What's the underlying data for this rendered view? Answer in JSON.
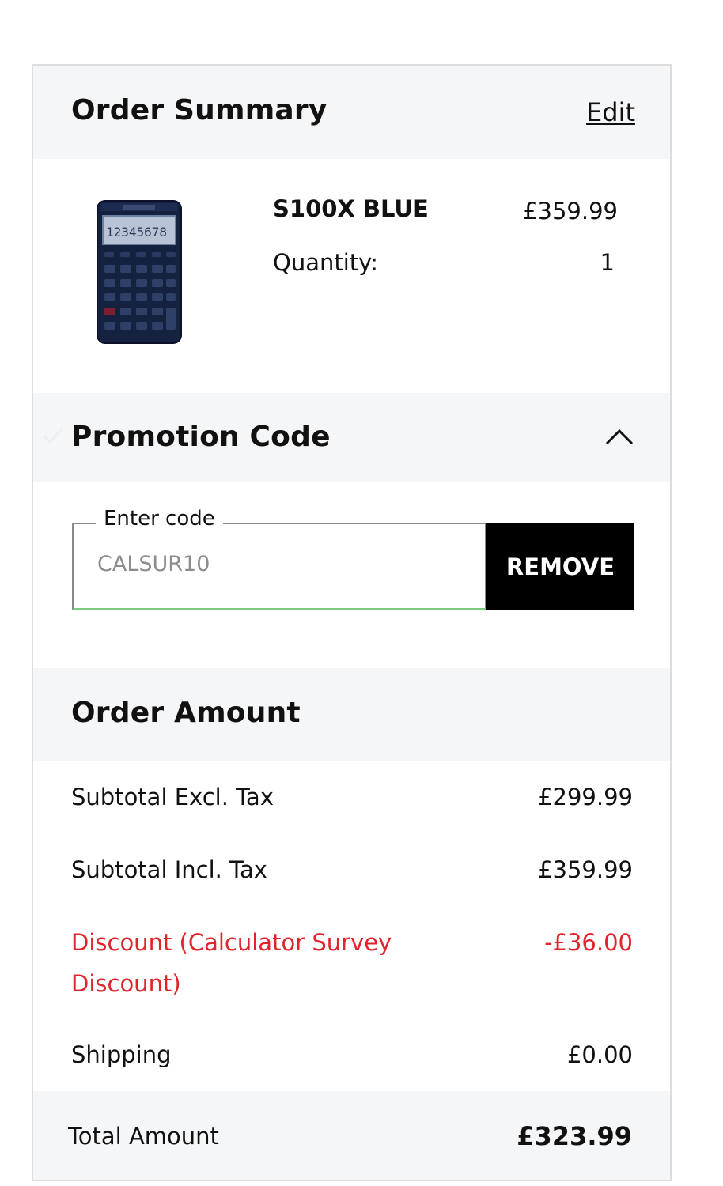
{
  "summary": {
    "title": "Order Summary",
    "edit_label": "Edit"
  },
  "product": {
    "name": "S100X BLUE",
    "price": "£359.99",
    "quantity_label": "Quantity:",
    "quantity_value": "1",
    "image_icon": "calculator-icon"
  },
  "promo": {
    "title": "Promotion Code",
    "field_label": "Enter code",
    "code_value": "CALSUR10",
    "remove_label": "REMOVE",
    "success_color": "#7ccb7c"
  },
  "amounts": {
    "title": "Order Amount",
    "rows": [
      {
        "label": "Subtotal Excl. Tax",
        "value": "£299.99"
      },
      {
        "label": "Subtotal Incl. Tax",
        "value": "£359.99"
      },
      {
        "label": "Discount (Calculator Survey Discount)",
        "value": "-£36.00"
      },
      {
        "label": "Shipping",
        "value": "£0.00"
      }
    ],
    "discount_color": "#e0242b",
    "total_label": "Total Amount",
    "total_value": "£323.99"
  }
}
